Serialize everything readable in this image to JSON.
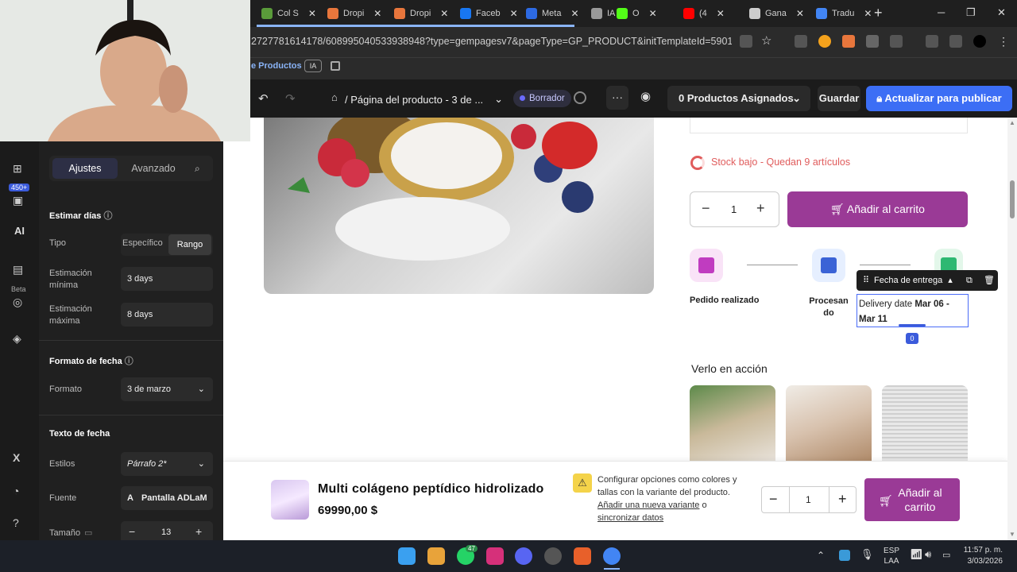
{
  "browser": {
    "tabs": [
      {
        "label": "Col S",
        "icon": "shopify-icon",
        "color": "#5a9b3a"
      },
      {
        "label": "Dropi",
        "icon": "dropi-icon",
        "color": "#e8763c"
      },
      {
        "label": "Dropi",
        "icon": "dropi-icon",
        "color": "#e8763c"
      },
      {
        "label": "Faceb",
        "icon": "facebook-icon",
        "color": "#1877f2"
      },
      {
        "label": "Meta",
        "icon": "meta-icon",
        "color": "#2d6ae3"
      },
      {
        "label": "IA",
        "icon": "ia-icon",
        "color": "#999999"
      },
      {
        "label": "O",
        "icon": "kick-icon",
        "color": "#53fc18"
      },
      {
        "label": "(4",
        "icon": "youtube-icon",
        "color": "#ff0000"
      },
      {
        "label": "Gana",
        "icon": "chatgpt-icon",
        "color": "#cccccc"
      },
      {
        "label": "Tradu",
        "icon": "translate-icon",
        "color": "#4285f4"
      }
    ],
    "url": "2727781614178/608995040533938948?type=gempagesv7&pageType=GP_PRODUCT&initTemplateId=59018313100...",
    "bookmark_label": "e Productos",
    "bookmark_ia": "IA"
  },
  "toolbar": {
    "page_title": "/ Página del producto - 3 de ...",
    "status": "Borrador",
    "more": "···",
    "assigned": "0 Productos Asignados",
    "save": "Guardar",
    "publish": "Actualizar para publicar"
  },
  "rail": {
    "badge": "450+",
    "beta": "Beta",
    "ai": "AI"
  },
  "panel": {
    "tab_settings": "Ajustes",
    "tab_advanced": "Avanzado",
    "estimate_title": "Estimar días",
    "type_label": "Tipo",
    "type_specific": "Específico",
    "type_range": "Rango",
    "min_label": "Estimación mínima",
    "min_value": "3 days",
    "max_label": "Estimación máxima",
    "max_value": "8 days",
    "format_title": "Formato de fecha",
    "format_label": "Formato",
    "format_value": "3 de marzo",
    "date_text_title": "Texto de fecha",
    "styles_label": "Estilos",
    "styles_value": "Párrafo 2*",
    "font_label": "Fuente",
    "font_value": "Pantalla ADLaM",
    "size_label": "Tamaño",
    "size_value": "13"
  },
  "product": {
    "stock_text": "Stock bajo - Quedan 9 artículos",
    "quantity": "1",
    "add_to_cart": "Añadir al carrito",
    "step1": "Pedido realizado",
    "step2": "Procesan do",
    "delivery_tag": "Fecha de entrega",
    "delivery_prefix": "Delivery date ",
    "delivery_range": "Mar 06 - Mar 11",
    "zero_badge": "0",
    "video_title": "Verlo en acción"
  },
  "sticky": {
    "name": "Multi colágeno peptídico hidrolizado",
    "price": "69990,00 $",
    "info_text": "Configurar opciones como colores y tallas con la variante del producto.",
    "link_variant": "Añadir una nueva variante",
    "or": " o ",
    "link_sync": "sincronizar datos",
    "quantity": "1",
    "add_to_cart": "Añadir al carrito"
  },
  "taskbar": {
    "whatsapp_badge": "47",
    "lang": "ESP",
    "lang2": "LAA",
    "time": "11:57 p. m.",
    "date": "3/03/2026"
  },
  "colors": {
    "accent": "#3c6ef5",
    "cart": "#9a3a96",
    "stock": "#e05c5c"
  }
}
